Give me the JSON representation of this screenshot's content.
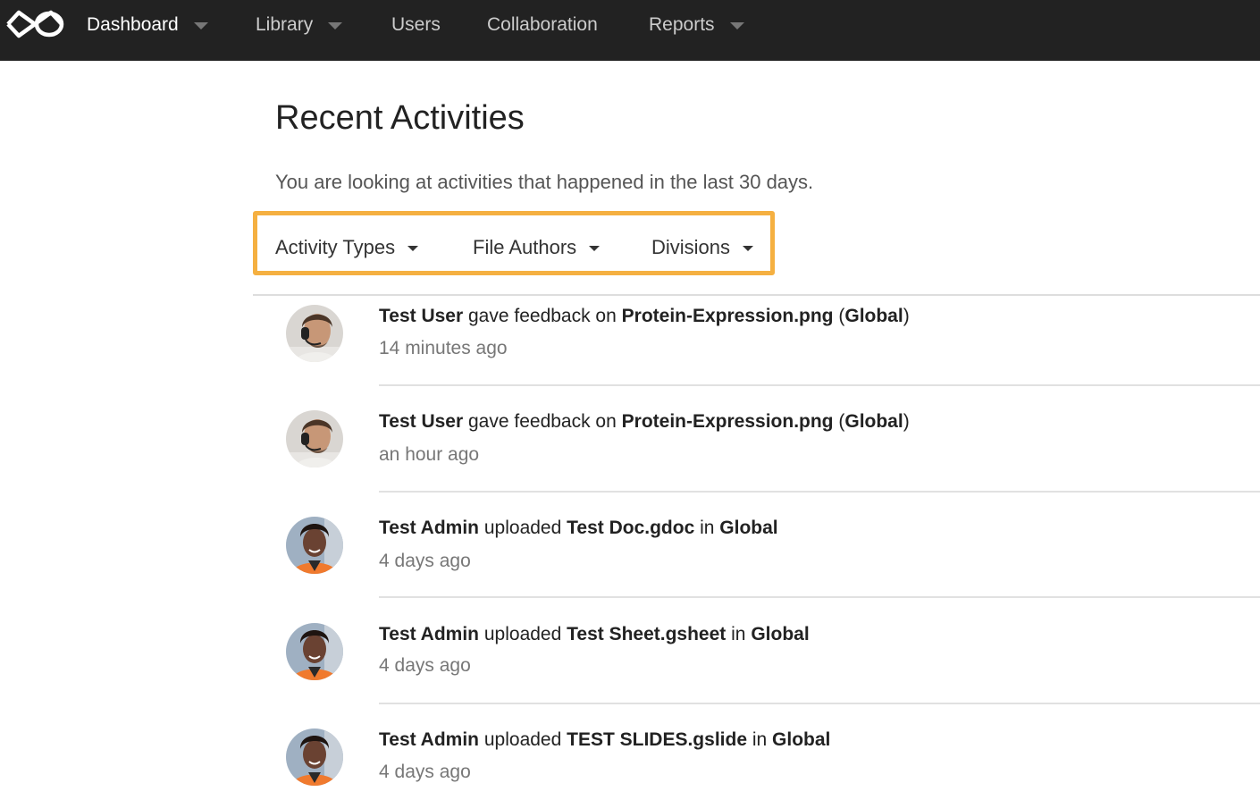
{
  "nav": {
    "logo_icon": "infinity-logo-icon",
    "items": [
      {
        "label": "Dashboard",
        "has_dropdown": true,
        "active": true
      },
      {
        "label": "Library",
        "has_dropdown": true
      },
      {
        "label": "Users",
        "has_dropdown": false
      },
      {
        "label": "Collaboration",
        "has_dropdown": false
      },
      {
        "label": "Reports",
        "has_dropdown": true
      }
    ]
  },
  "main": {
    "title": "Recent Activities",
    "subtitle": "You are looking at activities that happened in the last 30 days.",
    "highlight_color": "#f5b041",
    "filters": [
      {
        "label": "Activity Types"
      },
      {
        "label": "File Authors"
      },
      {
        "label": "Divisions"
      }
    ],
    "activities": [
      {
        "avatar": "user-avatar",
        "actor": "Test User",
        "verb": "gave feedback on",
        "object": "Protein-Expression.png",
        "paren_open": "(",
        "location": "Global",
        "paren_close": ")",
        "time": "14 minutes ago"
      },
      {
        "avatar": "user-avatar",
        "actor": "Test User",
        "verb": "gave feedback on",
        "object": "Protein-Expression.png",
        "paren_open": "(",
        "location": "Global",
        "paren_close": ")",
        "time": "an hour ago"
      },
      {
        "avatar": "admin-avatar",
        "actor": "Test Admin",
        "verb": "uploaded",
        "object": "Test Doc.gdoc",
        "preposition": "in",
        "location": "Global",
        "time": "4 days ago"
      },
      {
        "avatar": "admin-avatar",
        "actor": "Test Admin",
        "verb": "uploaded",
        "object": "Test Sheet.gsheet",
        "preposition": "in",
        "location": "Global",
        "time": "4 days ago"
      },
      {
        "avatar": "admin-avatar",
        "actor": "Test Admin",
        "verb": "uploaded",
        "object": "TEST SLIDES.gslide",
        "preposition": "in",
        "location": "Global",
        "time": "4 days ago"
      }
    ]
  }
}
